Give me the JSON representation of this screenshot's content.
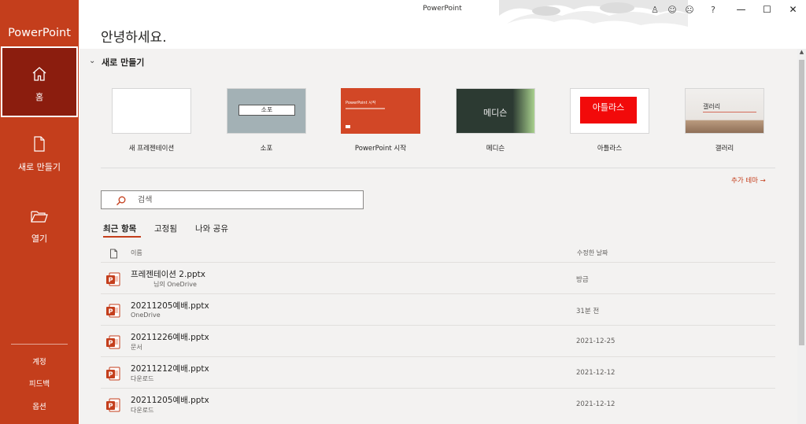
{
  "window": {
    "title": "PowerPoint"
  },
  "sidebar": {
    "app_name": "PowerPoint",
    "nav": [
      {
        "label": "홈",
        "icon": "home-icon",
        "active": true
      },
      {
        "label": "새로 만들기",
        "icon": "new-document-icon"
      },
      {
        "label": "열기",
        "icon": "folder-open-icon"
      }
    ],
    "footer": [
      "계정",
      "피드백",
      "옵션"
    ]
  },
  "header": {
    "greeting": "안녕하세요.",
    "controls": [
      {
        "name": "account-icon",
        "glyph": "♙"
      },
      {
        "name": "smile-feedback-icon",
        "glyph": "☺"
      },
      {
        "name": "frown-feedback-icon",
        "glyph": "☹"
      },
      {
        "name": "help-icon",
        "glyph": "?"
      }
    ],
    "window_controls": [
      {
        "name": "minimize-button",
        "glyph": "—"
      },
      {
        "name": "maximize-button",
        "glyph": "☐"
      },
      {
        "name": "close-button",
        "glyph": "✕"
      }
    ]
  },
  "new_section": {
    "title": "새로 만들기",
    "templates": [
      {
        "label": "새 프레젠테이션",
        "thumb_text": ""
      },
      {
        "label": "소포",
        "thumb_text": "소포"
      },
      {
        "label": "PowerPoint 시작",
        "thumb_text": "PowerPoint 시작"
      },
      {
        "label": "메디슨",
        "thumb_text": "메디슨"
      },
      {
        "label": "아틀라스",
        "thumb_text": "아틀라스"
      },
      {
        "label": "갤러리",
        "thumb_text": "갤러리"
      }
    ],
    "more_themes": "추가 테마 →"
  },
  "search": {
    "placeholder": "검색",
    "value": ""
  },
  "tabs": [
    {
      "label": "최근 항목",
      "active": true
    },
    {
      "label": "고정됨"
    },
    {
      "label": "나와 공유"
    }
  ],
  "file_list": {
    "columns": {
      "name": "이름",
      "date": "수정한 날짜"
    },
    "rows": [
      {
        "name": "프레젠테이션 2.pptx",
        "location": "님의 OneDrive",
        "date": "방금"
      },
      {
        "name": "20211205예배.pptx",
        "location": "OneDrive",
        "date": "31분 전"
      },
      {
        "name": "20211226예배.pptx",
        "location": "문서",
        "date": "2021-12-25"
      },
      {
        "name": "20211212예배.pptx",
        "location": "다운로드",
        "date": "2021-12-12"
      },
      {
        "name": "20211205예배.pptx",
        "location": "다운로드",
        "date": "2021-12-12"
      }
    ]
  },
  "colors": {
    "accent": "#c43e1c",
    "sidebar_active": "#8b1d0e",
    "content_bg": "#f3f2f1"
  }
}
